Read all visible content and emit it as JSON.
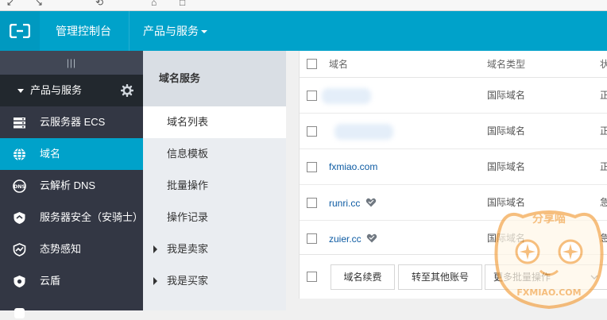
{
  "header": {
    "console_label": "管理控制台",
    "products_label": "产品与服务"
  },
  "sidebar": {
    "toggle_glyph": "|||",
    "section_label": "产品与服务",
    "items": [
      {
        "label": "云服务器 ECS",
        "icon": "server-icon"
      },
      {
        "label": "域名",
        "icon": "globe-icon",
        "active": true
      },
      {
        "label": "云解析 DNS",
        "icon": "dns-icon"
      },
      {
        "label": "服务器安全（安骑士）",
        "icon": "shield-icon"
      },
      {
        "label": "态势感知",
        "icon": "trend-icon"
      },
      {
        "label": "云盾",
        "icon": "cloud-shield-icon"
      }
    ]
  },
  "subnav": {
    "title": "域名服务",
    "items": [
      {
        "label": "域名列表",
        "active": true
      },
      {
        "label": "信息模板"
      },
      {
        "label": "批量操作"
      },
      {
        "label": "操作记录"
      },
      {
        "label": "我是卖家",
        "expandable": true
      },
      {
        "label": "我是买家",
        "expandable": true
      }
    ]
  },
  "table": {
    "columns": [
      "域名",
      "域名类型",
      "状"
    ],
    "rows": [
      {
        "domain": "",
        "blurred": true,
        "type": "国际域名",
        "status": "正"
      },
      {
        "domain": "",
        "blurred": true,
        "type": "国际域名",
        "status": "正"
      },
      {
        "domain": "fxmiao.com",
        "type": "国际域名",
        "status": "正"
      },
      {
        "domain": "runri.cc",
        "heart": true,
        "type": "国际域名",
        "status": "急"
      },
      {
        "domain": "zuier.cc",
        "heart": true,
        "type": "国际域名",
        "status": "急"
      }
    ]
  },
  "footer": {
    "renew_label": "域名续费",
    "transfer_label": "转至其他账号",
    "batch_label": "更多批量操作"
  },
  "watermark": {
    "text": "分享喵",
    "site": "FXMIAO.COM"
  },
  "colors": {
    "topbar": "#00a2ca",
    "sidebar": "#333744",
    "link": "#0d5ba3"
  }
}
